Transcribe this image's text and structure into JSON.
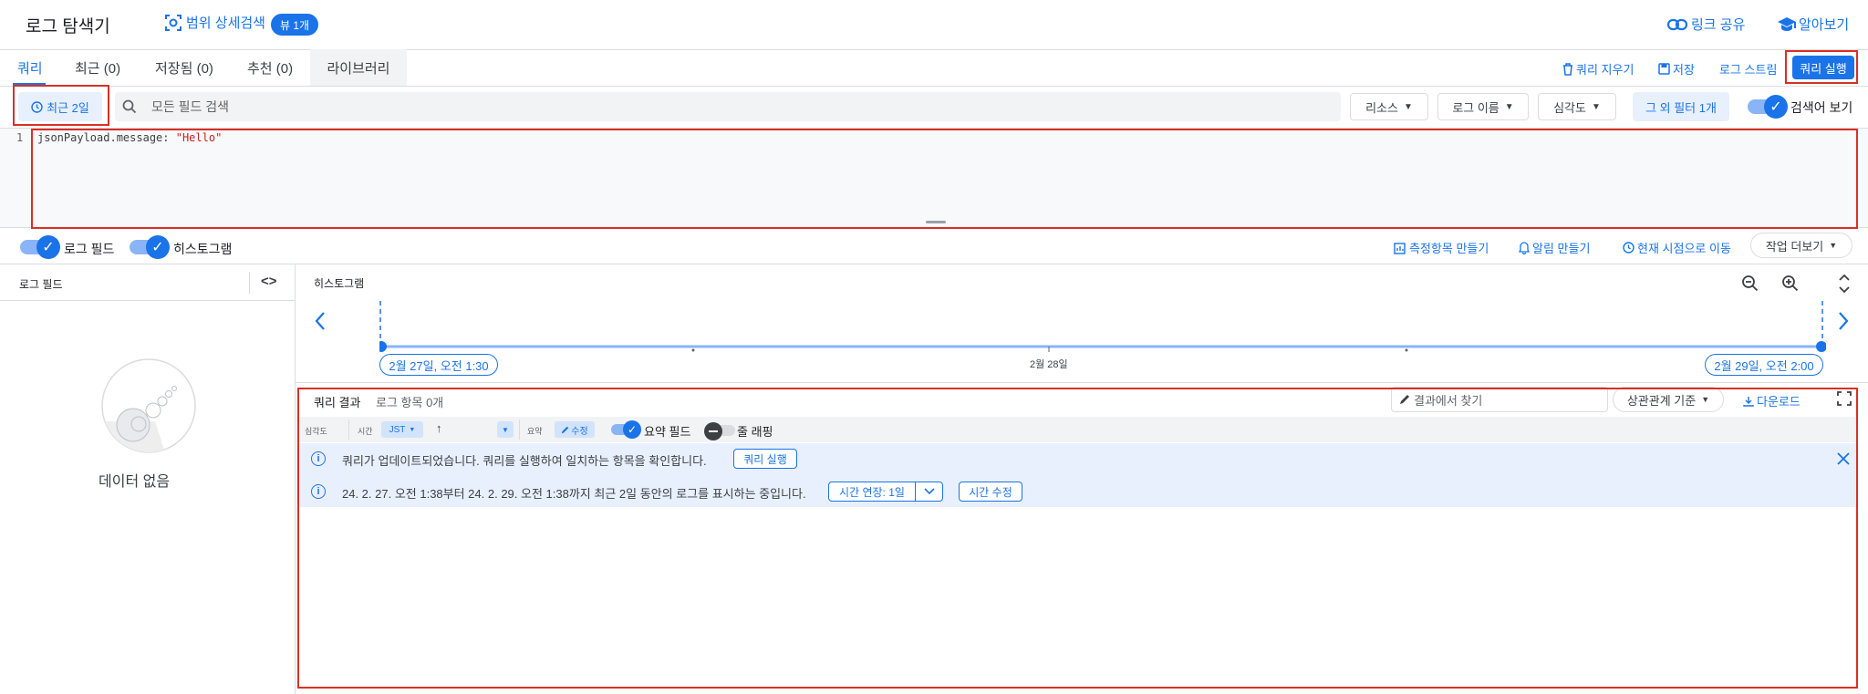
{
  "header": {
    "title": "로그 탐색기",
    "scope_search": "범위 상세검색",
    "view_badge": "뷰 1개",
    "share_link": "링크 공유",
    "learn": "알아보기"
  },
  "tabs": [
    {
      "label": "쿼리"
    },
    {
      "label": "최근 (0)"
    },
    {
      "label": "저장됨 (0)"
    },
    {
      "label": "추천 (0)"
    },
    {
      "label": "라이브러리"
    }
  ],
  "toolbar": {
    "clear_query": "쿼리 지우기",
    "save": "저장",
    "stream_logs": "로그 스트림",
    "run_query": "쿼리 실행"
  },
  "filter_bar": {
    "time_range": "최근 2일",
    "search_placeholder": "모든 필드 검색",
    "resource": "리소스",
    "log_name": "로그 이름",
    "severity": "심각도",
    "other_filters": "그 외 필터 1개",
    "show_query": "검색어 보기"
  },
  "editor": {
    "line_number": "1",
    "query_key": "jsonPayload.message:",
    "query_value": "\"Hello\""
  },
  "options_bar": {
    "log_fields_toggle": "로그 필드",
    "histogram_toggle": "히스토그램",
    "create_metric": "측정항목 만들기",
    "create_alert": "알림 만들기",
    "jump_to_now": "현재 시점으로 이동",
    "more_actions": "작업 더보기"
  },
  "log_fields_panel": {
    "title": "로그 필드",
    "empty_text": "데이터 없음"
  },
  "histogram": {
    "title": "히스토그램",
    "start_label": "2월 27일, 오전 1:30",
    "mid_label": "2월 28일",
    "end_label": "2월 29일, 오전 2:00"
  },
  "results": {
    "title": "쿼리 결과",
    "count": "로그 항목 0개",
    "find_placeholder": "결과에서 찾기",
    "sort": "상관관계 기준",
    "download": "다운로드",
    "col_severity": "심각도",
    "col_time": "시간",
    "timezone": "JST",
    "col_summary": "요약",
    "edit": "수정",
    "summary_fields": "요약 필드",
    "line_wrap": "줄 래핑",
    "notice1_text": "쿼리가 업데이트되었습니다. 쿼리를 실행하여 일치하는 항목을 확인합니다.",
    "notice1_button": "쿼리 실행",
    "notice2_text": "24. 2. 27. 오전 1:38부터 24. 2. 29. 오전 1:38까지 최근 2일 동안의 로그를 표시하는 중입니다.",
    "extend_time": "시간 연장: 1일",
    "edit_time": "시간 수정"
  }
}
